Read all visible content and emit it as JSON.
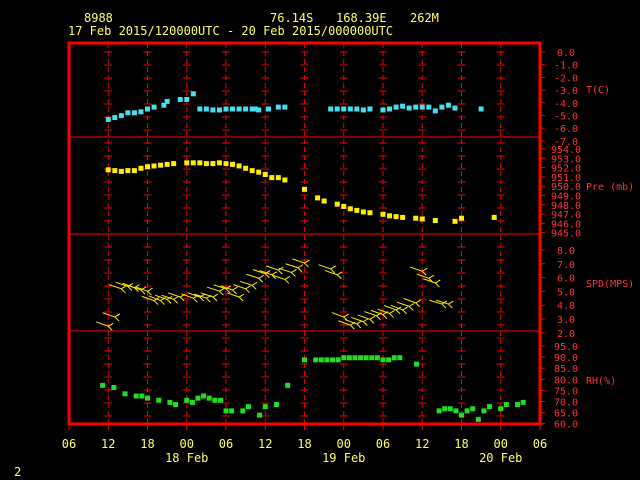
{
  "header": {
    "station": "8988",
    "lat": "76.14S",
    "lon": "168.39E",
    "elev": "262M",
    "range": "17 Feb 2015/120000UTC - 20 Feb 2015/000000UTC"
  },
  "footer": {
    "page": "2"
  },
  "colors": {
    "frame": "#ff0000",
    "label": "#ff3333",
    "header": "#ffff66",
    "temp": "#44e0f0",
    "pres": "#ffee00",
    "wind": "#ffee00",
    "rh": "#22dd22"
  },
  "chart_data": {
    "type": "scatter",
    "x_unit": "hours from 17 Feb 06UTC",
    "x_range": [
      0,
      72
    ],
    "x_ticks": [
      "06",
      "12",
      "18",
      "00",
      "06",
      "12",
      "18",
      "00",
      "06",
      "12",
      "18",
      "00",
      "06"
    ],
    "x_day_labels": [
      {
        "at": 18,
        "text": "18 Feb"
      },
      {
        "at": 42,
        "text": "19 Feb"
      },
      {
        "at": 66,
        "text": "20 Feb"
      }
    ],
    "panels": [
      {
        "id": "temp",
        "label": "T(C)",
        "range": [
          -8,
          0
        ],
        "ticks": [
          "0.0",
          "-1.0",
          "-2.0",
          "-3.0",
          "-4.0",
          "-5.0",
          "-6.0",
          "-7.0"
        ],
        "points": [
          [
            6,
            -7.1
          ],
          [
            7,
            -6.9
          ],
          [
            8,
            -6.7
          ],
          [
            9,
            -6.4
          ],
          [
            10,
            -6.4
          ],
          [
            11,
            -6.3
          ],
          [
            12,
            -6.0
          ],
          [
            13,
            -5.8
          ],
          [
            14.5,
            -5.6
          ],
          [
            15,
            -5.2
          ],
          [
            17,
            -5.0
          ],
          [
            18,
            -5.0
          ],
          [
            19,
            -4.4
          ],
          [
            20,
            -6.0
          ],
          [
            21,
            -6.0
          ],
          [
            22,
            -6.1
          ],
          [
            23,
            -6.1
          ],
          [
            24,
            -6.0
          ],
          [
            25,
            -6.0
          ],
          [
            26,
            -6.0
          ],
          [
            27,
            -6.0
          ],
          [
            28,
            -6.0
          ],
          [
            28.5,
            -6.0
          ],
          [
            29,
            -6.1
          ],
          [
            30.5,
            -6.0
          ],
          [
            32,
            -5.8
          ],
          [
            33,
            -5.8
          ],
          [
            40,
            -6.0
          ],
          [
            41,
            -6.0
          ],
          [
            42,
            -6.0
          ],
          [
            43,
            -6.0
          ],
          [
            44,
            -6.0
          ],
          [
            45,
            -6.1
          ],
          [
            46,
            -6.0
          ],
          [
            48,
            -6.1
          ],
          [
            49,
            -6.0
          ],
          [
            50,
            -5.8
          ],
          [
            51,
            -5.7
          ],
          [
            52,
            -5.9
          ],
          [
            53,
            -5.8
          ],
          [
            54,
            -5.8
          ],
          [
            55,
            -5.8
          ],
          [
            56,
            -6.2
          ],
          [
            57,
            -5.8
          ],
          [
            58,
            -5.6
          ],
          [
            59,
            -5.9
          ],
          [
            63,
            -6.0
          ]
        ]
      },
      {
        "id": "pres",
        "label": "Pre (mb)",
        "range": [
          945,
          955
        ],
        "ticks": [
          "954.0",
          "953.0",
          "952.0",
          "951.0",
          "950.0",
          "949.0",
          "948.0",
          "947.0",
          "946.0",
          "945.0"
        ],
        "points": [
          [
            6,
            952.2
          ],
          [
            7,
            952.1
          ],
          [
            8,
            952.0
          ],
          [
            9,
            952.1
          ],
          [
            10,
            952.1
          ],
          [
            11,
            952.4
          ],
          [
            12,
            952.6
          ],
          [
            13,
            952.7
          ],
          [
            14,
            952.8
          ],
          [
            15,
            952.9
          ],
          [
            16,
            953.0
          ],
          [
            18,
            953.1
          ],
          [
            19,
            953.1
          ],
          [
            20,
            953.1
          ],
          [
            21,
            953.0
          ],
          [
            22,
            953.0
          ],
          [
            23,
            953.1
          ],
          [
            24,
            953.0
          ],
          [
            25,
            952.9
          ],
          [
            26,
            952.7
          ],
          [
            27,
            952.4
          ],
          [
            28,
            952.1
          ],
          [
            29,
            951.9
          ],
          [
            30,
            951.6
          ],
          [
            31,
            951.2
          ],
          [
            32,
            951.2
          ],
          [
            33,
            950.9
          ],
          [
            36,
            949.7
          ],
          [
            38,
            948.6
          ],
          [
            39,
            948.2
          ],
          [
            41,
            947.8
          ],
          [
            42,
            947.5
          ],
          [
            43,
            947.2
          ],
          [
            44,
            947.0
          ],
          [
            45,
            946.8
          ],
          [
            46,
            946.7
          ],
          [
            48,
            946.5
          ],
          [
            49,
            946.3
          ],
          [
            50,
            946.2
          ],
          [
            51,
            946.1
          ],
          [
            53,
            946.0
          ],
          [
            54,
            945.9
          ],
          [
            56,
            945.7
          ],
          [
            59,
            945.6
          ],
          [
            60,
            946.0
          ],
          [
            65,
            946.1
          ]
        ]
      },
      {
        "id": "wind",
        "label": "SPD(MPS)",
        "range": [
          2,
          9
        ],
        "ticks": [
          "8.0",
          "7.0",
          "6.0",
          "5.0",
          "4.0",
          "3.0",
          "2.0"
        ],
        "points": [
          [
            6,
            2.4,
            210
          ],
          [
            7,
            3.2,
            200
          ],
          [
            8,
            5.6,
            200
          ],
          [
            9,
            5.8,
            200
          ],
          [
            10,
            5.7,
            210
          ],
          [
            11,
            5.5,
            210
          ],
          [
            12,
            5.4,
            210
          ],
          [
            13,
            4.6,
            200
          ],
          [
            14,
            4.6,
            220
          ],
          [
            15,
            4.7,
            200
          ],
          [
            16,
            4.7,
            200
          ],
          [
            17,
            4.9,
            200
          ],
          [
            19,
            4.8,
            210
          ],
          [
            20,
            4.9,
            200
          ],
          [
            21,
            4.8,
            200
          ],
          [
            22,
            4.9,
            200
          ],
          [
            23,
            5.4,
            190
          ],
          [
            24,
            5.6,
            190
          ],
          [
            25,
            5.5,
            200
          ],
          [
            26,
            4.9,
            200
          ],
          [
            27,
            5.6,
            200
          ],
          [
            28,
            5.9,
            190
          ],
          [
            29,
            6.5,
            190
          ],
          [
            30,
            6.9,
            190
          ],
          [
            31,
            6.8,
            200
          ],
          [
            32,
            7.2,
            200
          ],
          [
            33,
            6.4,
            200
          ],
          [
            34,
            7.0,
            190
          ],
          [
            35,
            7.4,
            190
          ],
          [
            36,
            7.8,
            200
          ],
          [
            40,
            7.3,
            200
          ],
          [
            41,
            6.8,
            200
          ],
          [
            42,
            3.2,
            210
          ],
          [
            43,
            2.5,
            210
          ],
          [
            44,
            2.6,
            210
          ],
          [
            45,
            2.8,
            200
          ],
          [
            46,
            3.0,
            200
          ],
          [
            47,
            3.3,
            200
          ],
          [
            48,
            3.4,
            200
          ],
          [
            49,
            3.5,
            210
          ],
          [
            50,
            3.8,
            210
          ],
          [
            51,
            3.8,
            220
          ],
          [
            52,
            4.1,
            200
          ],
          [
            53,
            4.4,
            210
          ],
          [
            54,
            7.1,
            200
          ],
          [
            55,
            6.5,
            200
          ],
          [
            56,
            6.1,
            200
          ],
          [
            57,
            4.3,
            180
          ],
          [
            58,
            4.3,
            180
          ]
        ]
      },
      {
        "id": "rh",
        "label": "RH(%)",
        "range": [
          60,
          100
        ],
        "ticks": [
          "95.0",
          "90.0",
          "85.0",
          "80.0",
          "75.0",
          "70.0",
          "65.0",
          "60.0"
        ],
        "points": [
          [
            6,
            81
          ],
          [
            8,
            80
          ],
          [
            10,
            77
          ],
          [
            12,
            76
          ],
          [
            13,
            76
          ],
          [
            14,
            75
          ],
          [
            16,
            74
          ],
          [
            18,
            73
          ],
          [
            19,
            72
          ],
          [
            21,
            74
          ],
          [
            22,
            73
          ],
          [
            23,
            75
          ],
          [
            24,
            76
          ],
          [
            25,
            75
          ],
          [
            26,
            74
          ],
          [
            27,
            74
          ],
          [
            28,
            69
          ],
          [
            29,
            69
          ],
          [
            31,
            69
          ],
          [
            32,
            71
          ],
          [
            34,
            67
          ],
          [
            35,
            71
          ],
          [
            37,
            72
          ],
          [
            39,
            81
          ],
          [
            42,
            93
          ],
          [
            44,
            93
          ],
          [
            45,
            93
          ],
          [
            46,
            93
          ],
          [
            47,
            93
          ],
          [
            48,
            93
          ],
          [
            49,
            94
          ],
          [
            50,
            94
          ],
          [
            51,
            94
          ],
          [
            52,
            94
          ],
          [
            53,
            94
          ],
          [
            54,
            94
          ],
          [
            55,
            94
          ],
          [
            56,
            93
          ],
          [
            57,
            93
          ],
          [
            58,
            94
          ],
          [
            59,
            94
          ],
          [
            62,
            91
          ],
          [
            66,
            69
          ],
          [
            67,
            70
          ],
          [
            68,
            70
          ],
          [
            69,
            69
          ],
          [
            70,
            67
          ],
          [
            71,
            69
          ],
          [
            72,
            70
          ],
          [
            73,
            65
          ],
          [
            74,
            69
          ],
          [
            75,
            71
          ],
          [
            77,
            70
          ],
          [
            78,
            72
          ],
          [
            80,
            72
          ],
          [
            81,
            73
          ]
        ]
      }
    ]
  }
}
